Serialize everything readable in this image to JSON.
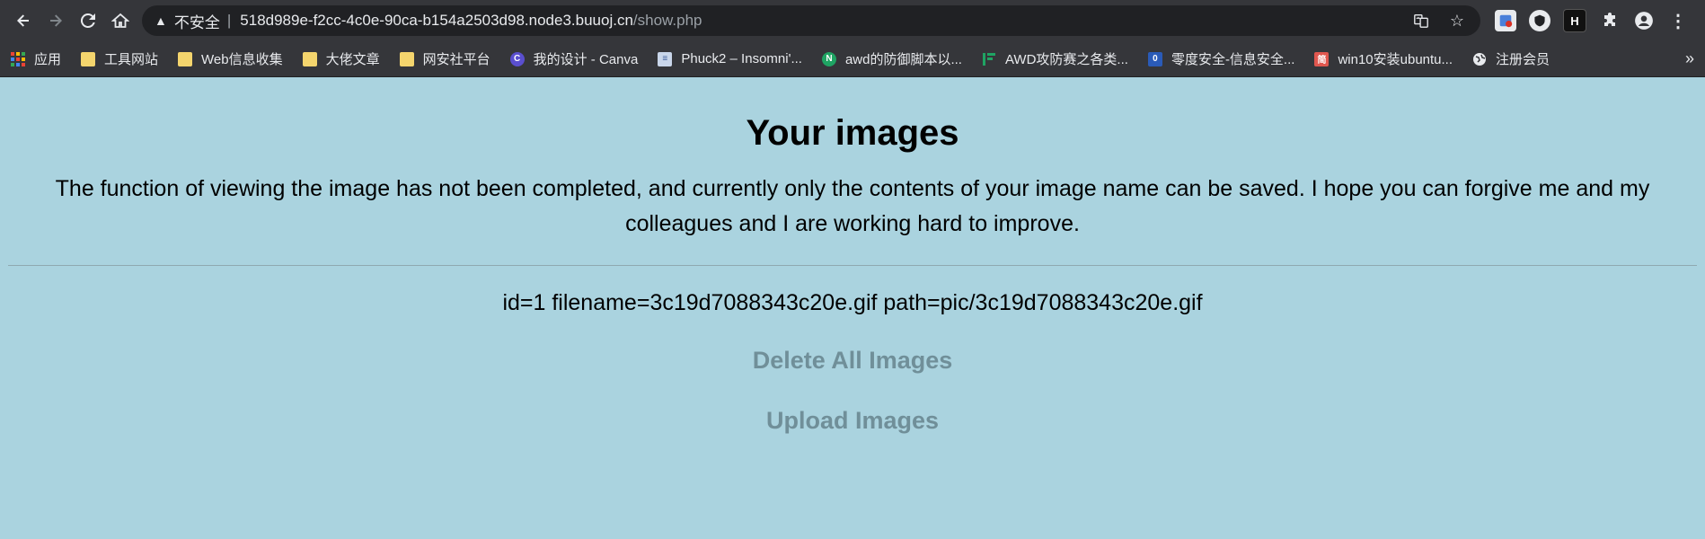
{
  "browser": {
    "address": {
      "security_label": "不安全",
      "host": "518d989e-f2cc-4c0e-90ca-b154a2503d98.node3.buuoj.cn",
      "path": "/show.php"
    },
    "bookmarks": [
      {
        "label": "应用",
        "icon": "apps-grid-icon"
      },
      {
        "label": "工具网站",
        "icon": "folder-icon"
      },
      {
        "label": "Web信息收集",
        "icon": "folder-icon"
      },
      {
        "label": "大佬文章",
        "icon": "folder-icon"
      },
      {
        "label": "网安社平台",
        "icon": "folder-icon"
      },
      {
        "label": "我的设计 - Canva",
        "icon": "canva-icon"
      },
      {
        "label": "Phuck2 – Insomni'...",
        "icon": "page-icon"
      },
      {
        "label": "awd的防御脚本以...",
        "icon": "n-icon"
      },
      {
        "label": "AWD攻防赛之各类...",
        "icon": "bars-icon"
      },
      {
        "label": "零度安全-信息安全...",
        "icon": "zero-icon"
      },
      {
        "label": "win10安装ubuntu...",
        "icon": "jian-icon"
      },
      {
        "label": "注册会员",
        "icon": "globe-icon"
      }
    ]
  },
  "page": {
    "title": "Your images",
    "description": "The function of viewing the image has not been completed, and currently only the contents of your image name can be saved. I hope you can forgive me and my colleagues and I are working hard to improve.",
    "record": "id=1 filename=3c19d7088343c20e.gif path=pic/3c19d7088343c20e.gif",
    "delete_label": "Delete All Images",
    "upload_label": "Upload Images"
  },
  "colors": {
    "page_background": "#aad3df",
    "action_link": "#708f99",
    "chrome": "#35363a"
  }
}
